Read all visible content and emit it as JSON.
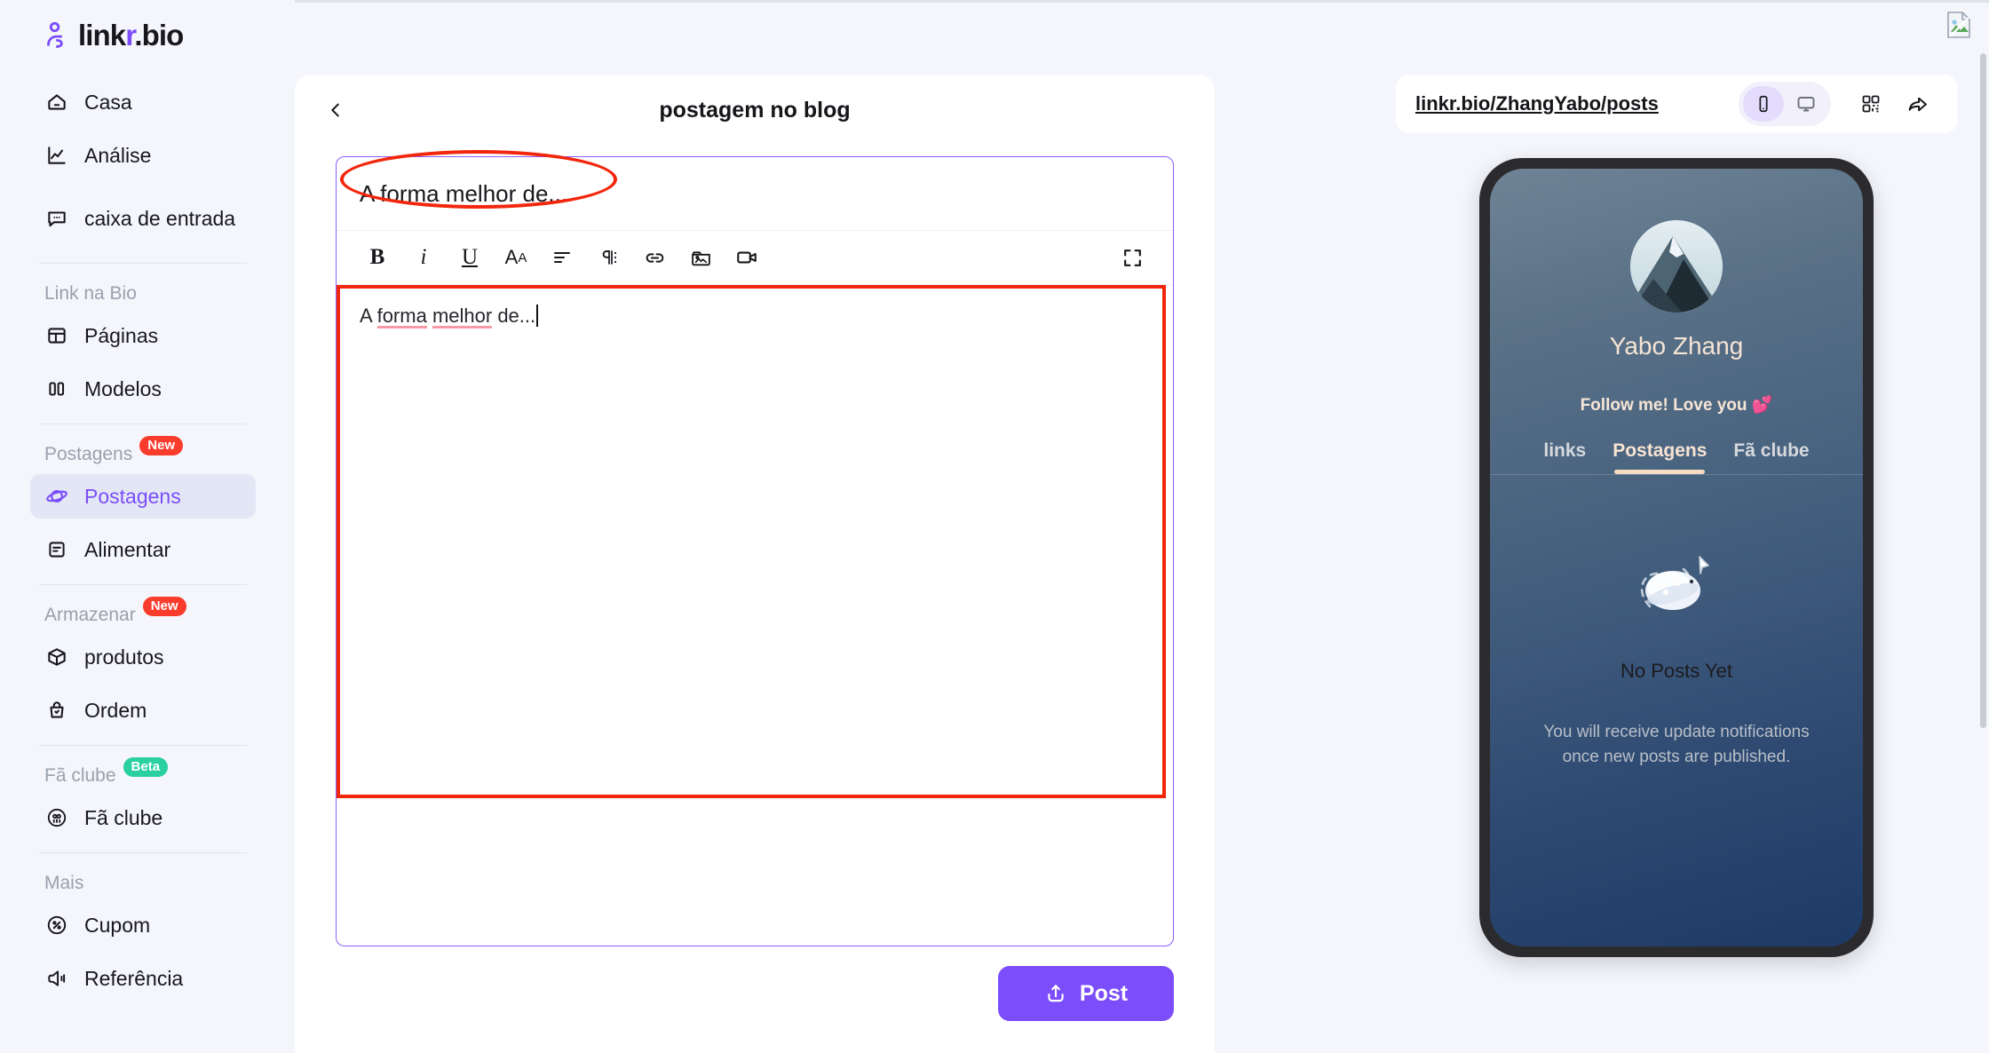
{
  "brand": {
    "name_prefix": "link",
    "name_accent": "r",
    "name_suffix": ".bio",
    "accent_color": "#7b4dfb"
  },
  "sidebar": {
    "top_items": [
      {
        "label": "Casa",
        "icon": "home-icon"
      },
      {
        "label": "Análise",
        "icon": "analytics-icon"
      },
      {
        "label": "caixa de entrada",
        "icon": "inbox-icon"
      }
    ],
    "sections": [
      {
        "title": "Link na Bio",
        "badge": null,
        "items": [
          {
            "label": "Páginas",
            "icon": "pages-icon",
            "active": false
          },
          {
            "label": "Modelos",
            "icon": "templates-icon",
            "active": false
          }
        ]
      },
      {
        "title": "Postagens",
        "badge": "New",
        "badge_kind": "new",
        "items": [
          {
            "label": "Postagens",
            "icon": "planet-icon",
            "active": true
          },
          {
            "label": "Alimentar",
            "icon": "feed-icon",
            "active": false
          }
        ]
      },
      {
        "title": "Armazenar",
        "badge": "New",
        "badge_kind": "new",
        "items": [
          {
            "label": "produtos",
            "icon": "box-icon",
            "active": false
          },
          {
            "label": "Ordem",
            "icon": "bag-icon",
            "active": false
          }
        ]
      },
      {
        "title": "Fã clube",
        "badge": "Beta",
        "badge_kind": "beta",
        "items": [
          {
            "label": "Fã clube",
            "icon": "fanclub-icon",
            "active": false
          }
        ]
      },
      {
        "title": "Mais",
        "badge": null,
        "items": [
          {
            "label": "Cupom",
            "icon": "coupon-icon",
            "active": false
          },
          {
            "label": "Referência",
            "icon": "megaphone-icon",
            "active": false
          }
        ]
      }
    ]
  },
  "editor": {
    "back_icon": "chevron-left-icon",
    "title": "postagem no blog",
    "post_title_value": "A forma melhor de...",
    "post_title_placeholder": "Título",
    "body_segments": [
      {
        "text": "A ",
        "spell": false
      },
      {
        "text": "forma",
        "spell": true
      },
      {
        "text": " ",
        "spell": false
      },
      {
        "text": "melhor",
        "spell": true
      },
      {
        "text": " de...",
        "spell": false
      }
    ],
    "body_plain": "A forma melhor de...",
    "toolbar": [
      {
        "name": "bold-icon",
        "glyph": "B"
      },
      {
        "name": "italic-icon",
        "glyph": "i"
      },
      {
        "name": "underline-icon",
        "glyph": "U"
      },
      {
        "name": "font-size-icon",
        "glyph": "Aa"
      },
      {
        "name": "align-icon",
        "glyph": ""
      },
      {
        "name": "paragraph-icon",
        "glyph": "¶"
      },
      {
        "name": "link-icon",
        "glyph": ""
      },
      {
        "name": "image-icon",
        "glyph": ""
      },
      {
        "name": "video-icon",
        "glyph": ""
      }
    ],
    "fullscreen_icon": "fullscreen-icon",
    "post_button": "Post",
    "post_button_icon": "upload-icon",
    "annotation_color": "#f2260c"
  },
  "preview": {
    "url": "linkr.bio/ZhangYabo/posts",
    "view_modes": [
      {
        "name": "mobile-view-toggle",
        "active": true
      },
      {
        "name": "desktop-view-toggle",
        "active": false
      }
    ],
    "qr_icon": "qr-code-icon",
    "share_icon": "share-icon",
    "profile": {
      "name": "Yabo Zhang",
      "bio": "Follow me! Love you 💕",
      "avatar_alt": "mountain-avatar"
    },
    "tabs": [
      {
        "label": "links",
        "active": false
      },
      {
        "label": "Postagens",
        "active": true
      },
      {
        "label": "Fã clube",
        "active": false
      }
    ],
    "empty_state": {
      "illustration": "planet-illustration",
      "title": "No Posts Yet",
      "subtitle": "You will receive update notifications once new posts are published."
    }
  },
  "topbar": {
    "avatar_icon": "broken-image-avatar"
  }
}
